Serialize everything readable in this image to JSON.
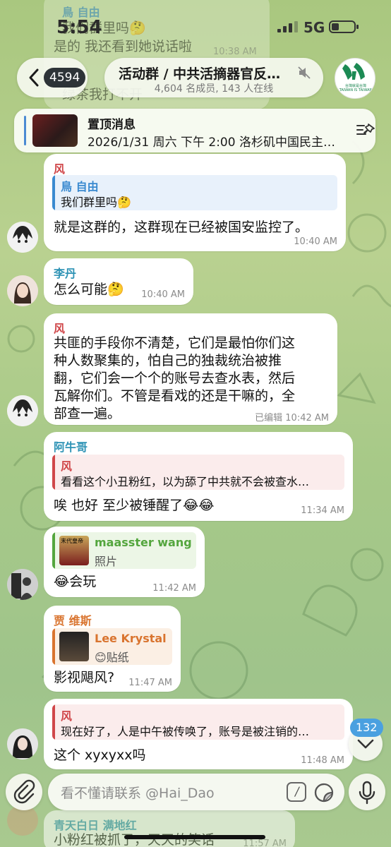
{
  "status_bar": {
    "time": "5:54",
    "network": "5G"
  },
  "header": {
    "back_count": "4594",
    "title": "活动群 / 中共活摘器官反…",
    "subtitle": "4,604 名成员, 143 人在线"
  },
  "group_logo": {
    "caption": "台灣就是台灣 TAIWAN IS TAIWAN"
  },
  "pinned": {
    "label": "置顶消息",
    "text": "2026/1/31 周六 下午 2:00 洛杉矶中国民主…"
  },
  "top_partial": {
    "sender": "鳥 自由",
    "line1": "我们群里吗🤔",
    "line2": "是的 我还看到她说话啦",
    "line2_time": "10:38 AM",
    "line3": "绿茶我打不开"
  },
  "messages": [
    {
      "sender": "风",
      "reply_name": "鳥 自由",
      "reply_text": "我们群里吗🤔",
      "text": "就是这群的，这群现在已经被国安监控了。",
      "time": "10:40 AM"
    },
    {
      "sender": "李丹",
      "text": "怎么可能🤔",
      "time": "10:40 AM"
    },
    {
      "sender": "风",
      "lines": [
        "共匪的手段你不清楚，它们是最怕你们这",
        "种人数聚集的，怕自己的独裁统治被推",
        "翻，它们会一个个的账号去查水表，然后",
        "瓦解你们。不管是看戏的还是干嘛的，全",
        "部查一遍。"
      ],
      "time": "已编辑 10:42 AM"
    },
    {
      "sender": "阿牛哥",
      "reply_name": "风",
      "reply_text": "看看这个小丑粉红，以为舔了中共就不会被查水…",
      "text": "唉 也好 至少被锤醒了😂😂",
      "time": "11:34 AM"
    },
    {
      "reply_name": "maasster wang",
      "reply_text": "照片",
      "thumb_caption": "末代皇帝",
      "text": "😂会玩",
      "time": "11:42 AM"
    },
    {
      "sender": "贾 维斯",
      "reply_name": "Lee Krystal",
      "reply_text": "😊贴纸",
      "text": "影视飓风?",
      "time": "11:47 AM"
    },
    {
      "reply_name": "风",
      "reply_text": "现在好了，人是中午被传唤了，账号是被注销的…",
      "text": "这个 xyxyxx吗",
      "time": "11:48 AM"
    }
  ],
  "bottom_partial": {
    "sender": "青天白日 满地红",
    "text": "小粉红被抓了，天天的笑话",
    "time": "11:57 AM"
  },
  "scroll": {
    "unread": "132"
  },
  "composer": {
    "placeholder": "看不懂请联系 @Hai_Dao",
    "command_glyph": "/"
  },
  "colors": {
    "blue_name": "#3a8ad0",
    "red_name": "#d0474a",
    "teal_name": "#2e93b5",
    "green_name": "#54a63e",
    "orange_name": "#d9742f"
  }
}
